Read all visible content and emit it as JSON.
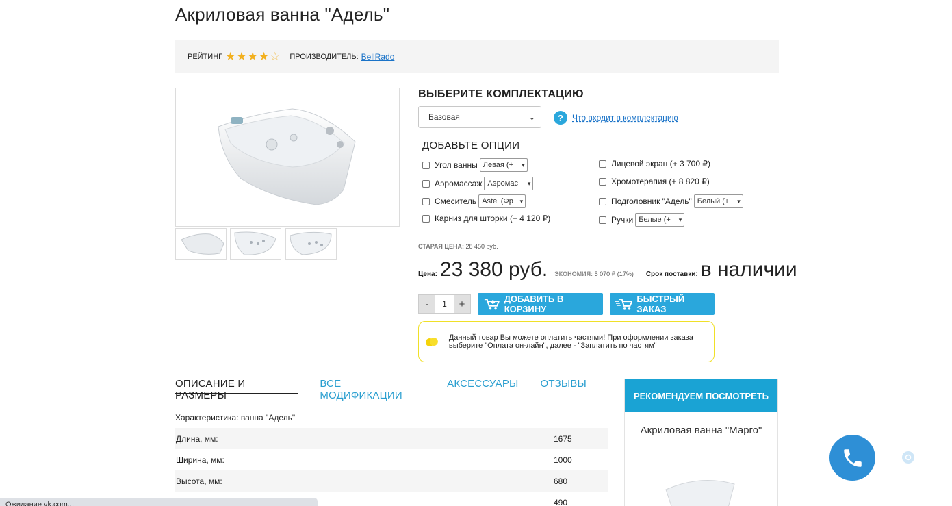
{
  "product": {
    "title": "Акриловая ванна \"Адель\""
  },
  "meta": {
    "rating_label": "РЕЙТИНГ",
    "rating": 4,
    "rating_max": 5,
    "maker_label": "ПРОИЗВОДИТЕЛЬ:",
    "maker_name": "BellRado"
  },
  "configuration": {
    "title": "ВЫБЕРИТЕ КОМПЛЕКТАЦИЮ",
    "selected": "Базовая",
    "help_link": "Что входит в комплектацию"
  },
  "options": {
    "title": "ДОБАВЬТЕ ОПЦИИ",
    "left": [
      {
        "label": "Угол ванны",
        "select": "Левая (+"
      },
      {
        "label": "Аэромассаж",
        "select": "Аэромас"
      },
      {
        "label": "Смеситель",
        "select": "Astel (Фр"
      },
      {
        "label": "Карниз для шторки (+ 4 120 ₽)",
        "select": ""
      }
    ],
    "right": [
      {
        "label": "Лицевой экран (+ 3 700 ₽)",
        "select": ""
      },
      {
        "label": "Хромотерапия (+ 8 820 ₽)",
        "select": ""
      },
      {
        "label": "Подголовник \"Адель\"",
        "select": "Белый (+"
      },
      {
        "label": "Ручки",
        "select": "Белые (+"
      }
    ]
  },
  "pricing": {
    "old_label": "СТАРАЯ ЦЕНА:",
    "old_value": "28 450 руб.",
    "price_label": "Цена:",
    "price_value": "23 380 руб.",
    "economy_label": "ЭКОНОМИЯ:",
    "economy_value": "5 070 ₽ (17%)",
    "delivery_label": "Срок поставки:",
    "delivery_value": "в наличии"
  },
  "cart": {
    "qty_minus": "-",
    "qty": "1",
    "qty_plus": "+",
    "add_label": "ДОБАВИТЬ В КОРЗИНУ",
    "quick_label": "БЫСТРЫЙ ЗАКАЗ"
  },
  "installment": {
    "text": "Данный товар Вы можете оплатить частями! При оформлении заказа выберите \"Оплата он-лайн\", далее - \"Заплатить по частям\""
  },
  "tabs": [
    "ОПИСАНИЕ И РАЗМЕРЫ",
    "ВСЕ МОДИФИКАЦИИ",
    "АКСЕССУАРЫ",
    "ОТЗЫВЫ"
  ],
  "specs": {
    "title": "Характеристика: ванна \"Адель\"",
    "rows": [
      {
        "key": "Длина, мм:",
        "value": "1675"
      },
      {
        "key": "Ширина, мм:",
        "value": "1000"
      },
      {
        "key": "Высота, мм:",
        "value": "680"
      },
      {
        "key": "",
        "value": "490"
      }
    ]
  },
  "recommend": {
    "title": "РЕКОМЕНДУЕМ ПОСМОТРЕТЬ",
    "item_name": "Акриловая ванна \"Марго\""
  },
  "status_bar": {
    "text": "Ожидание vk.com..."
  },
  "colors": {
    "accent": "#2aa7dc",
    "star": "#f2b01e",
    "info_border": "#f0e028",
    "call": "#2e8fd6"
  }
}
